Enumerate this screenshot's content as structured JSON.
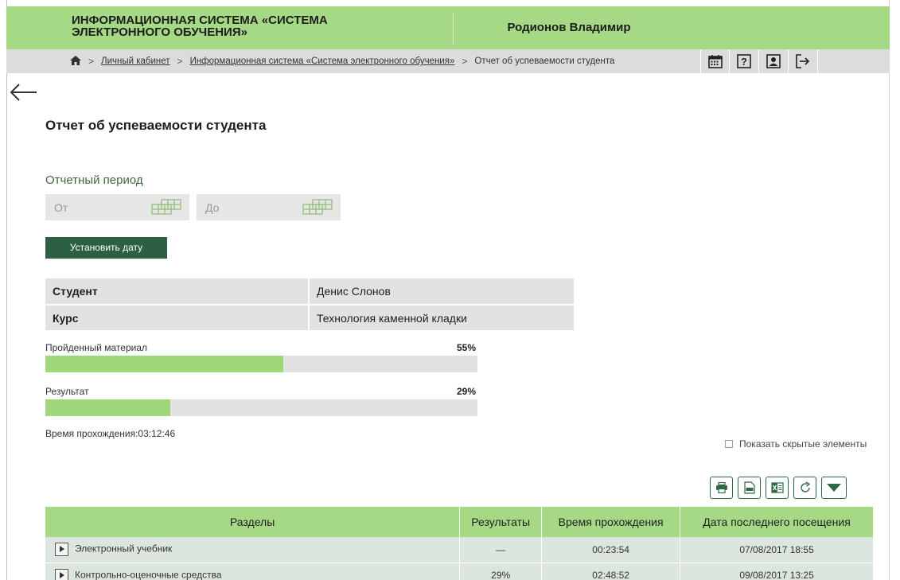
{
  "header": {
    "app_title": "ИНФОРМАЦИОННАЯ СИСТЕМА «СИСТЕМА ЭЛЕКТРОННОГО ОБУЧЕНИЯ»",
    "user_name": "Родионов Владимир",
    "bg_color": "#a6d985"
  },
  "breadcrumb": {
    "home_icon": "home-icon",
    "items": [
      {
        "label": "Личный кабинет"
      },
      {
        "label": "Информационная система «Система электронного обучения»"
      },
      {
        "label": "Отчет об успеваемости студента"
      }
    ]
  },
  "toolbar": {
    "icons": [
      "calendar-icon",
      "help-icon",
      "profile-icon",
      "logout-icon"
    ],
    "help_glyph": "?"
  },
  "page": {
    "title": "Отчет об успеваемости студента",
    "period_label": "Отчетный период",
    "from_placeholder": "От",
    "to_placeholder": "До",
    "set_date_button": "Установить дату"
  },
  "student_info": {
    "student_key": "Студент",
    "student_value": "Денис Слонов",
    "course_key": "Курс",
    "course_value": "Технология каменной кладки"
  },
  "progress": {
    "material_label": "Пройденный материал",
    "material_value": "55%",
    "material_fraction": 0.55,
    "result_label": "Результат",
    "result_value": "29%",
    "result_fraction": 0.29,
    "fill_color": "#9fd87b"
  },
  "time_spent": "Время прохождения:03:12:46",
  "show_hidden_label": "Показать скрытые элементы",
  "export_buttons": [
    "print-icon",
    "pdf-icon",
    "excel-icon",
    "refresh-icon",
    "dropdown-icon"
  ],
  "table": {
    "headers": [
      "Разделы",
      "Результаты",
      "Время прохождения",
      "Дата последнего посещения"
    ],
    "rows": [
      {
        "name": "Электронный учебник",
        "result": "—",
        "time": "00:23:54",
        "date": "07/08/2017 18:55"
      },
      {
        "name": "Контрольно-оценочные средства",
        "result": "29%",
        "time": "02:48:52",
        "date": "09/08/2017 13:25"
      }
    ]
  }
}
